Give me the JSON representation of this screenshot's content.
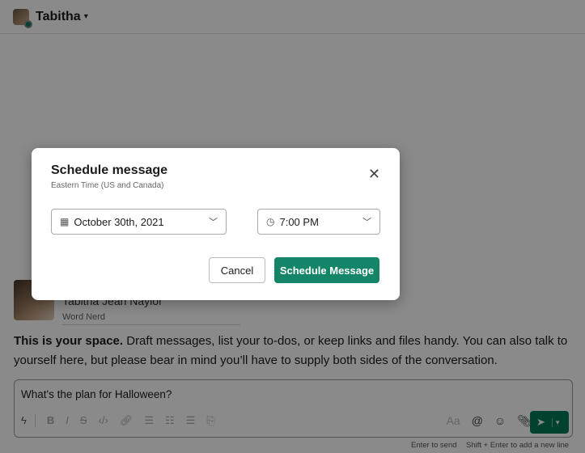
{
  "header": {
    "user_name": "Tabitha",
    "status_color": "#007a5a"
  },
  "profile": {
    "name": "Tabitha Jean Naylor",
    "title": "Word Nerd"
  },
  "intro": {
    "bold": "This is your space.",
    "text": " Draft messages, list your to-dos, or keep links and files handy. You can also talk to yourself here, but please bear in mind you’ll have to supply both sides of the conversation."
  },
  "composer": {
    "text": "What's the plan for Halloween?",
    "tools": [
      "shortcuts",
      "bold",
      "italic",
      "strikethrough",
      "code",
      "link",
      "ordered-list",
      "bulleted-list",
      "blockquote",
      "code-block"
    ],
    "right_tools": [
      "formatting",
      "mention",
      "emoji",
      "attach"
    ],
    "send_color": "#007a5a"
  },
  "hints": {
    "enter": "Enter to send",
    "shift": "Shift + Enter to add a new line"
  },
  "modal": {
    "title": "Schedule message",
    "subtitle": "Eastern Time (US and Canada)",
    "date": "October 30th, 2021",
    "time": "7:00 PM",
    "cancel": "Cancel",
    "schedule": "Schedule Message",
    "accent": "#148567"
  }
}
